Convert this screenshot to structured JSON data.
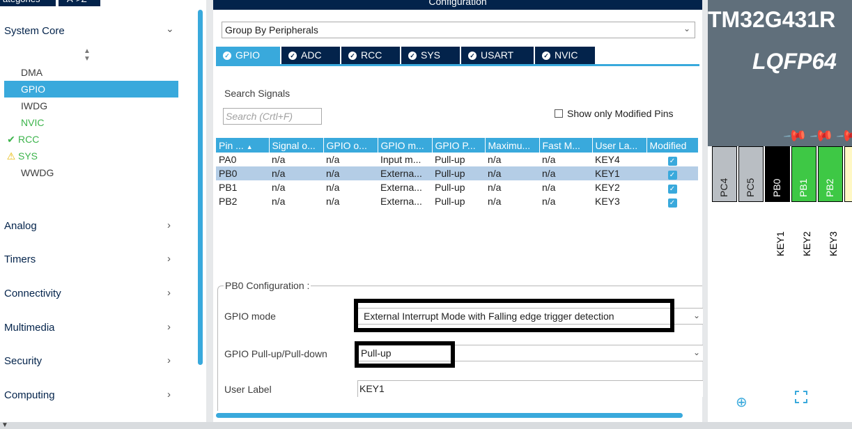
{
  "left_panel": {
    "top_tabs": [
      "ategories",
      "A->Z"
    ],
    "system_core": {
      "label": "System Core",
      "items": [
        {
          "label": "DMA",
          "state": "normal"
        },
        {
          "label": "GPIO",
          "state": "selected"
        },
        {
          "label": "IWDG",
          "state": "normal"
        },
        {
          "label": "NVIC",
          "state": "configured-text"
        },
        {
          "label": "RCC",
          "state": "ok"
        },
        {
          "label": "SYS",
          "state": "warning"
        },
        {
          "label": "WWDG",
          "state": "normal"
        }
      ]
    },
    "categories": [
      "Analog",
      "Timers",
      "Connectivity",
      "Multimedia",
      "Security",
      "Computing"
    ]
  },
  "config_panel": {
    "title": "Configuration",
    "group_by": "Group By Peripherals",
    "tabs": [
      "GPIO",
      "ADC",
      "RCC",
      "SYS",
      "USART",
      "NVIC"
    ],
    "active_tab": "GPIO",
    "search_label": "Search Signals",
    "search_placeholder": "Search (Crtl+F)",
    "show_modified_label": "Show only Modified Pins",
    "table": {
      "columns": [
        "Pin ...",
        "Signal o...",
        "GPIO o...",
        "GPIO m...",
        "GPIO P...",
        "Maximu...",
        "Fast M...",
        "User La...",
        "Modified"
      ],
      "rows": [
        {
          "pin": "PA0",
          "signal": "n/a",
          "gpio_o": "n/a",
          "gpio_m": "Input m...",
          "gpio_p": "Pull-up",
          "max": "n/a",
          "fast": "n/a",
          "user": "KEY4",
          "modified": true,
          "selected": false
        },
        {
          "pin": "PB0",
          "signal": "n/a",
          "gpio_o": "n/a",
          "gpio_m": "Externa...",
          "gpio_p": "Pull-up",
          "max": "n/a",
          "fast": "n/a",
          "user": "KEY1",
          "modified": true,
          "selected": true
        },
        {
          "pin": "PB1",
          "signal": "n/a",
          "gpio_o": "n/a",
          "gpio_m": "Externa...",
          "gpio_p": "Pull-up",
          "max": "n/a",
          "fast": "n/a",
          "user": "KEY2",
          "modified": true,
          "selected": false
        },
        {
          "pin": "PB2",
          "signal": "n/a",
          "gpio_o": "n/a",
          "gpio_m": "Externa...",
          "gpio_p": "Pull-up",
          "max": "n/a",
          "fast": "n/a",
          "user": "KEY3",
          "modified": true,
          "selected": false
        }
      ]
    },
    "pin_config": {
      "legend": "PB0 Configuration :",
      "gpio_mode_label": "GPIO mode",
      "gpio_mode_value": "External Interrupt Mode with Falling edge trigger detection",
      "pull_label": "GPIO Pull-up/Pull-down",
      "pull_value": "Pull-up",
      "user_label_label": "User Label",
      "user_label_value": "KEY1"
    }
  },
  "chip_view": {
    "name": "TM32G431R",
    "package": "LQFP64",
    "pins": [
      {
        "name": "PC4",
        "color": "gray"
      },
      {
        "name": "PC5",
        "color": "gray"
      },
      {
        "name": "PB0",
        "color": "black"
      },
      {
        "name": "PB1",
        "color": "green"
      },
      {
        "name": "PB2",
        "color": "green"
      }
    ],
    "pin_labels": [
      "KEY1",
      "KEY2",
      "KEY3"
    ]
  },
  "colors": {
    "navy": "#03234b",
    "accent_blue": "#39a9dc",
    "ok_green": "#3cb44b",
    "pin_green": "#3ec845",
    "selection_row": "#b4cde6",
    "chip_bg": "#606f7b"
  }
}
